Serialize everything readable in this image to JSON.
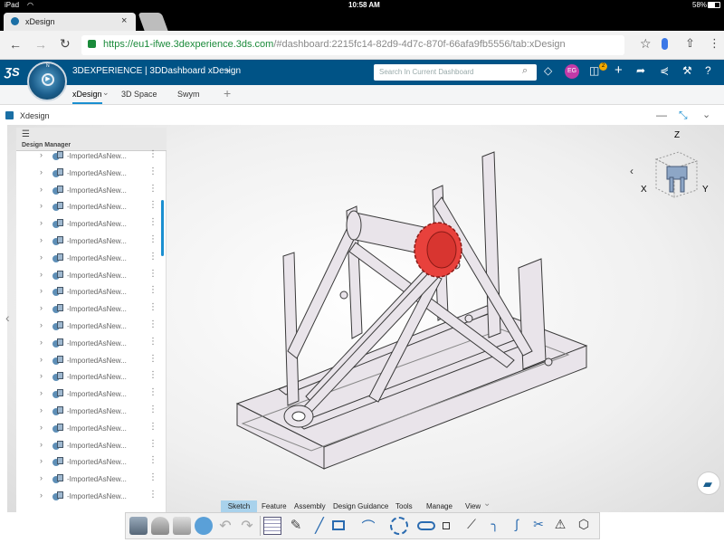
{
  "status_bar": {
    "device": "iPad",
    "time": "10:58 AM",
    "battery": "58%"
  },
  "browser": {
    "tab_title": "xDesign",
    "url_host": "https://eu1-ifwe.3dexperience.3ds.com",
    "url_path": "/#dashboard:2215fc14-82d9-4d7c-870f-66afa9fb5556/tab:xDesign"
  },
  "header": {
    "brand": "3DEXPERIENCE | 3DDashboard xDesign",
    "search_placeholder": "Search In Current Dashboard",
    "user_initials": "EG",
    "notification_count": "2",
    "compass_n": "N",
    "compass_play": "▶"
  },
  "app_tabs": [
    "xDesign",
    "3D Space",
    "Swym"
  ],
  "title_bar": {
    "title": "Xdesign"
  },
  "design_manager": {
    "title": "Design Manager",
    "item_label": "-ImportedAsNew...",
    "item_count": 21
  },
  "triad": {
    "z": "Z",
    "x": "X",
    "y": "Y"
  },
  "action_tabs": [
    "Sketch",
    "Feature",
    "Assembly",
    "Design Guidance",
    "Tools",
    "Manage",
    "View"
  ],
  "active_action_tab": "Sketch",
  "colors": {
    "header": "#005386",
    "accent": "#1a8fd0",
    "gear": "#e8413c",
    "url_green": "#1a8a3a"
  }
}
